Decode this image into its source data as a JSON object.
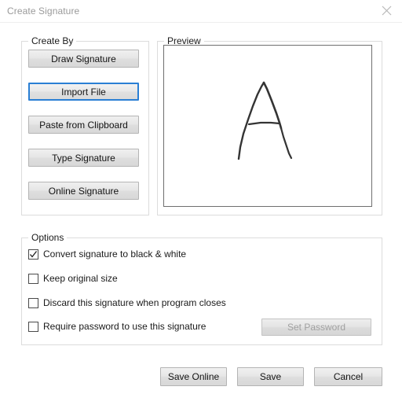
{
  "window": {
    "title": "Create Signature",
    "close_icon": "close-icon"
  },
  "create_by": {
    "legend": "Create By",
    "buttons": [
      {
        "label": "Draw Signature",
        "focused": false
      },
      {
        "label": "Import File",
        "focused": true
      },
      {
        "label": "Paste from Clipboard",
        "focused": false
      },
      {
        "label": "Type Signature",
        "focused": false
      },
      {
        "label": "Online Signature",
        "focused": false
      }
    ]
  },
  "preview": {
    "legend": "Preview",
    "signature_alt": "handwritten-letter-A"
  },
  "options": {
    "legend": "Options",
    "checkboxes": [
      {
        "label": "Convert signature to black & white",
        "checked": true
      },
      {
        "label": "Keep original size",
        "checked": false
      },
      {
        "label": "Discard this signature when program closes",
        "checked": false
      },
      {
        "label": "Require password to use this signature",
        "checked": false
      }
    ],
    "set_password_label": "Set Password",
    "set_password_enabled": false
  },
  "footer": {
    "save_online_label": "Save Online",
    "save_label": "Save",
    "cancel_label": "Cancel"
  },
  "colors": {
    "focus_blue": "#2a7fd4",
    "dialog_bg": "#ffffff",
    "group_border": "#dcdcdc",
    "button_face": "#e4e4e4",
    "title_text": "#9a9a9a",
    "disabled_text": "#a0a0a0",
    "ink": "#303030"
  }
}
